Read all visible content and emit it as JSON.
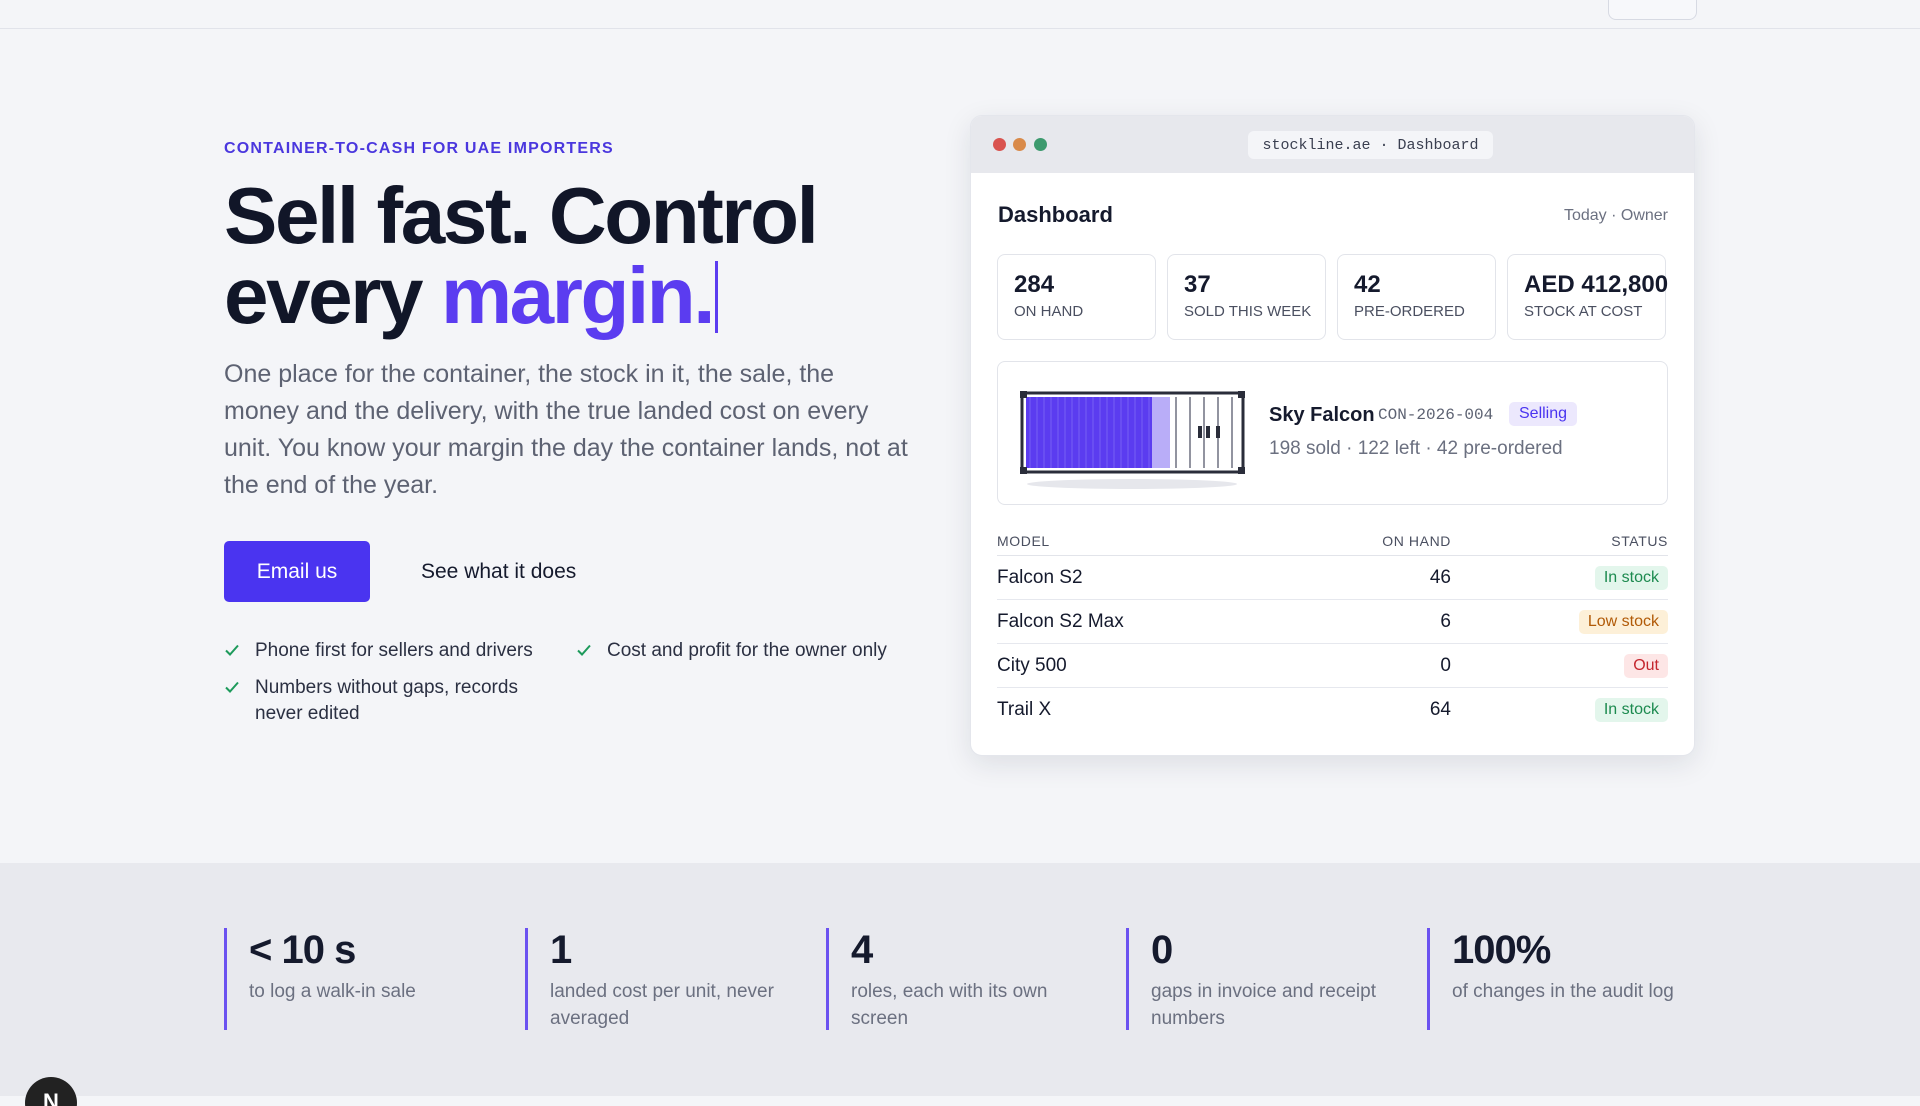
{
  "hero": {
    "eyebrow": "CONTAINER-TO-CASH FOR UAE IMPORTERS",
    "headline_line1": "Sell fast. Control",
    "headline_line2_prefix": "every",
    "headline_accent": "margin.",
    "lede": "One place for the container, the stock in it, the sale, the money and the delivery, with the true landed cost on every unit. You know your margin the day the container lands, not at the end of the year.",
    "primary_cta": "Email us",
    "secondary_cta": "See what it does",
    "checks": [
      "Phone first for sellers and drivers",
      "Cost and profit for the owner only",
      "Numbers without gaps, records never edited"
    ]
  },
  "preview": {
    "url": "stockline.ae · Dashboard",
    "title": "Dashboard",
    "meta": "Today · Owner",
    "kpis": [
      {
        "value": "284",
        "label": "ON HAND"
      },
      {
        "value": "37",
        "label": "SOLD THIS WEEK"
      },
      {
        "value": "42",
        "label": "PRE-ORDERED"
      },
      {
        "value": "AED 412,800",
        "label": "STOCK AT COST"
      }
    ],
    "container": {
      "name": "Sky Falcon",
      "code": "CON-2026-004",
      "status": "Selling",
      "summary": "198 sold · 122 left · 42 pre-ordered",
      "sold_fraction": 0.62
    },
    "table": {
      "headers": [
        "MODEL",
        "ON HAND",
        "STATUS"
      ],
      "rows": [
        {
          "model": "Falcon S2",
          "on_hand": "46",
          "status": "In stock"
        },
        {
          "model": "Falcon S2 Max",
          "on_hand": "6",
          "status": "Low stock"
        },
        {
          "model": "City 500",
          "on_hand": "0",
          "status": "Out"
        },
        {
          "model": "Trail X",
          "on_hand": "64",
          "status": "In stock"
        }
      ]
    }
  },
  "stats": [
    {
      "value": "< 10 s",
      "label": "to log a walk-in sale"
    },
    {
      "value": "1",
      "label": "landed cost per unit, never averaged"
    },
    {
      "value": "4",
      "label": "roles, each with its own screen"
    },
    {
      "value": "0",
      "label": "gaps in invoice and receipt numbers"
    },
    {
      "value": "100%",
      "label": "of changes in the audit log"
    }
  ],
  "colors": {
    "accent": "#4a34f0",
    "instock_bg": "#e3f6ec",
    "instock_fg": "#1c8a4f",
    "low_bg": "#fdf0d8",
    "low_fg": "#b15a07",
    "out_bg": "#fde6e6",
    "out_fg": "#c4262e"
  },
  "dev_badge": "N"
}
